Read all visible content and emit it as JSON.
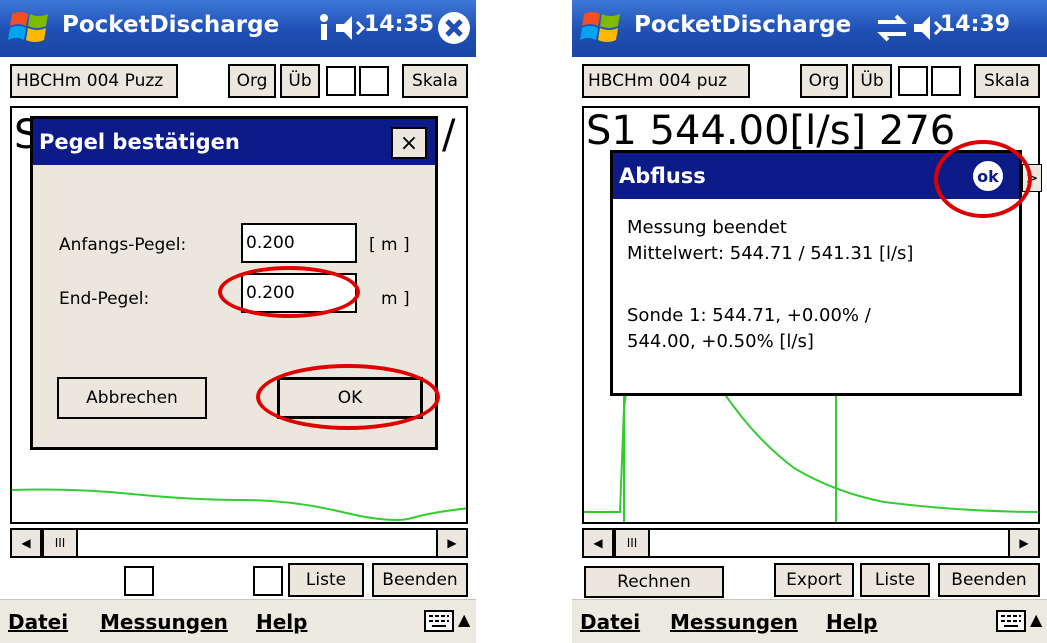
{
  "colors": {
    "titlebar": "#1f4fb4",
    "dialog_title": "#0c1b87",
    "button_face": "#ebe7de",
    "annotation": "#e00000",
    "curve": "#33cc33"
  },
  "left": {
    "title": "PocketDischarge",
    "clock": "14:35",
    "status_icons": [
      "info-icon",
      "speaker-icon",
      "close-circle-icon"
    ],
    "toolbar": {
      "device": "HBCHm 004 Puzz",
      "org": "Org",
      "ub": "Üb",
      "skala": "Skala"
    },
    "readout_fragment": "/",
    "dialog": {
      "title": "Pegel bestätigen",
      "close_label": "×",
      "start_label": "Anfangs-Pegel:",
      "start_value": "0.200",
      "start_unit": "[ m ]",
      "end_label": "End-Pegel:",
      "end_value": "0.200",
      "end_unit": "m ]",
      "cancel": "Abbrechen",
      "ok": "OK"
    },
    "scroll_thumb": "III",
    "bottom": {
      "liste": "Liste",
      "beenden": "Beenden"
    },
    "menu": {
      "file": "Datei",
      "measurements": "Messungen",
      "help": "Help"
    }
  },
  "right": {
    "title": "PocketDischarge",
    "clock": "14:39",
    "status_icons": [
      "sync-icon",
      "speaker-icon"
    ],
    "toolbar": {
      "device": "HBCHm 004 puz",
      "org": "Org",
      "ub": "Üb",
      "skala": "Skala"
    },
    "readout": "S1  544.00[l/s]   276",
    "dialog": {
      "title": "Abfluss",
      "ok": "ok",
      "more": ">",
      "line1": "Messung beendet",
      "line2": "Mittelwert: 544.71 / 541.31 [l/s]",
      "line3": "Sonde 1: 544.71, +0.00% /",
      "line4": "544.00, +0.50% [l/s]"
    },
    "scroll_thumb": "III",
    "bottom": {
      "rechnen": "Rechnen",
      "export": "Export",
      "liste": "Liste",
      "beenden": "Beenden"
    },
    "menu": {
      "file": "Datei",
      "measurements": "Messungen",
      "help": "Help"
    }
  }
}
